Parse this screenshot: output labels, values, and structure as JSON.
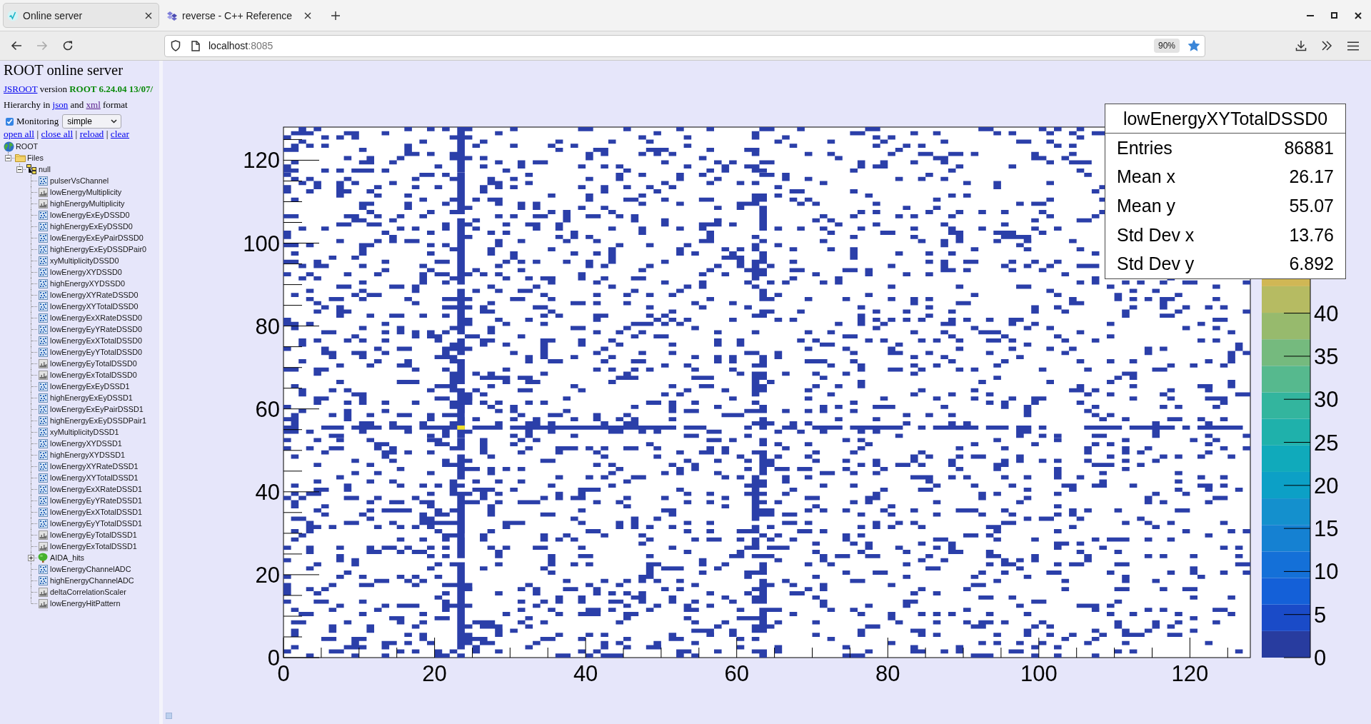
{
  "browser": {
    "tabs": [
      {
        "kind": "jsroot",
        "title": "Online server",
        "selected": true
      },
      {
        "kind": "cppref",
        "title": "reverse - C++ Reference",
        "selected": false
      }
    ],
    "navigation": [
      {
        "kind": "back",
        "disabled": false
      },
      {
        "kind": "forward",
        "disabled": true
      },
      {
        "kind": "reload",
        "disabled": false
      }
    ],
    "address": {
      "host": "localhost",
      "port": ":8085",
      "zoom": "90%",
      "bookmarked": true
    }
  },
  "sidebar": {
    "title": "ROOT online server",
    "version": [
      {
        "kind": "link",
        "text": "JSROOT",
        "visited": false
      },
      {
        "kind": "text",
        "text": "version"
      },
      {
        "kind": "release",
        "text": "ROOT 6.24.04 13/07/"
      }
    ],
    "hierarchy": [
      {
        "kind": "text",
        "text": "Hierarchy in"
      },
      {
        "kind": "link",
        "text": "json",
        "visited": false
      },
      {
        "kind": "text",
        "text": "and"
      },
      {
        "kind": "link",
        "text": "xml",
        "visited": true
      },
      {
        "kind": "text",
        "text": "format"
      }
    ],
    "monitoring": {
      "label": "Monitoring",
      "checked": true,
      "mode": "simple"
    },
    "actions": [
      {
        "kind": "link",
        "text": "open all",
        "visited": false
      },
      {
        "kind": "text",
        "text": "|"
      },
      {
        "kind": "link",
        "text": "close all",
        "visited": false
      },
      {
        "kind": "text",
        "text": "|"
      },
      {
        "kind": "link",
        "text": "reload",
        "visited": false
      },
      {
        "kind": "text",
        "text": "|"
      },
      {
        "kind": "link",
        "text": "clear",
        "visited": false
      }
    ],
    "tree": [
      {
        "kind": "root",
        "label": "ROOT",
        "children": [
          {
            "kind": "folder",
            "label": "Files",
            "expanded": true,
            "children": [
              {
                "kind": "file",
                "label": "null",
                "expanded": true,
                "children": [
                  {
                    "kind": "hist2d",
                    "label": "pulserVsChannel"
                  },
                  {
                    "kind": "hist1d",
                    "label": "lowEnergyMultiplicity"
                  },
                  {
                    "kind": "hist1d",
                    "label": "highEnergyMultiplicity"
                  },
                  {
                    "kind": "hist2d",
                    "label": "lowEnergyExEyDSSD0"
                  },
                  {
                    "kind": "hist2d",
                    "label": "highEnergyExEyDSSD0"
                  },
                  {
                    "kind": "hist2d",
                    "label": "lowEnergyExEyPairDSSD0"
                  },
                  {
                    "kind": "hist2d",
                    "label": "highEnergyExEyDSSDPair0"
                  },
                  {
                    "kind": "hist2d",
                    "label": "xyMultiplicityDSSD0"
                  },
                  {
                    "kind": "hist2d",
                    "label": "lowEnergyXYDSSD0"
                  },
                  {
                    "kind": "hist2d",
                    "label": "highEnergyXYDSSD0"
                  },
                  {
                    "kind": "hist2d",
                    "label": "lowEnergyXYRateDSSD0"
                  },
                  {
                    "kind": "hist2d",
                    "label": "lowEnergyXYTotalDSSD0"
                  },
                  {
                    "kind": "hist2d",
                    "label": "lowEnergyExXRateDSSD0"
                  },
                  {
                    "kind": "hist2d",
                    "label": "lowEnergyEyYRateDSSD0"
                  },
                  {
                    "kind": "hist2d",
                    "label": "lowEnergyExXTotalDSSD0"
                  },
                  {
                    "kind": "hist2d",
                    "label": "lowEnergyEyYTotalDSSD0"
                  },
                  {
                    "kind": "hist1d",
                    "label": "lowEnergyEyTotalDSSD0"
                  },
                  {
                    "kind": "hist1d",
                    "label": "lowEnergyExTotalDSSD0"
                  },
                  {
                    "kind": "hist2d",
                    "label": "lowEnergyExEyDSSD1"
                  },
                  {
                    "kind": "hist2d",
                    "label": "highEnergyExEyDSSD1"
                  },
                  {
                    "kind": "hist2d",
                    "label": "lowEnergyExEyPairDSSD1"
                  },
                  {
                    "kind": "hist2d",
                    "label": "highEnergyExEyDSSDPair1"
                  },
                  {
                    "kind": "hist2d",
                    "label": "xyMultiplicityDSSD1"
                  },
                  {
                    "kind": "hist2d",
                    "label": "lowEnergyXYDSSD1"
                  },
                  {
                    "kind": "hist2d",
                    "label": "highEnergyXYDSSD1"
                  },
                  {
                    "kind": "hist2d",
                    "label": "lowEnergyXYRateDSSD1"
                  },
                  {
                    "kind": "hist2d",
                    "label": "lowEnergyXYTotalDSSD1"
                  },
                  {
                    "kind": "hist2d",
                    "label": "lowEnergyExXRateDSSD1"
                  },
                  {
                    "kind": "hist2d",
                    "label": "lowEnergyEyYRateDSSD1"
                  },
                  {
                    "kind": "hist2d",
                    "label": "lowEnergyExXTotalDSSD1"
                  },
                  {
                    "kind": "hist2d",
                    "label": "lowEnergyEyYTotalDSSD1"
                  },
                  {
                    "kind": "hist1d",
                    "label": "lowEnergyEyTotalDSSD1"
                  },
                  {
                    "kind": "hist1d",
                    "label": "lowEnergyExTotalDSSD1"
                  },
                  {
                    "kind": "ttree",
                    "label": "AIDA_hits",
                    "expanded": false
                  },
                  {
                    "kind": "hist2d",
                    "label": "lowEnergyChannelADC"
                  },
                  {
                    "kind": "hist2d",
                    "label": "highEnergyChannelADC"
                  },
                  {
                    "kind": "hist1d",
                    "label": "deltaCorrelationScaler"
                  },
                  {
                    "kind": "hist1d",
                    "label": "lowEnergyHitPattern"
                  }
                ]
              }
            ]
          }
        ]
      }
    ]
  },
  "canvas": {
    "histogram": {
      "y_ticks": [
        "120",
        "100",
        "80",
        "60",
        "40",
        "20",
        "0"
      ],
      "x_ticks": [
        "0",
        "20",
        "40",
        "60",
        "80",
        "100",
        "120"
      ],
      "palette_ticks": [
        "40",
        "35",
        "30",
        "25",
        "20",
        "15",
        "10",
        "5",
        "0"
      ]
    },
    "stats": {
      "title": "lowEnergyXYTotalDSSD0",
      "rows": [
        {
          "label": "Entries",
          "value": "86881"
        },
        {
          "label": "Mean x",
          "value": "26.17"
        },
        {
          "label": "Mean y",
          "value": "55.07"
        },
        {
          "label": "Std Dev x",
          "value": "13.76"
        },
        {
          "label": "Std Dev y",
          "value": "6.892"
        }
      ]
    }
  }
}
